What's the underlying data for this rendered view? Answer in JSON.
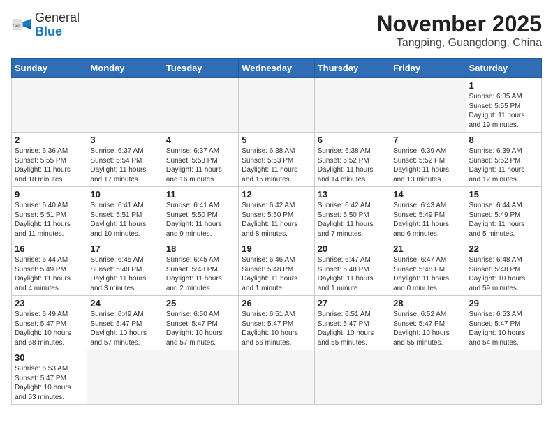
{
  "header": {
    "logo_general": "General",
    "logo_blue": "Blue",
    "month_title": "November 2025",
    "location": "Tangping, Guangdong, China"
  },
  "days_of_week": [
    "Sunday",
    "Monday",
    "Tuesday",
    "Wednesday",
    "Thursday",
    "Friday",
    "Saturday"
  ],
  "weeks": [
    [
      {
        "day": "",
        "info": ""
      },
      {
        "day": "",
        "info": ""
      },
      {
        "day": "",
        "info": ""
      },
      {
        "day": "",
        "info": ""
      },
      {
        "day": "",
        "info": ""
      },
      {
        "day": "",
        "info": ""
      },
      {
        "day": "1",
        "info": "Sunrise: 6:35 AM\nSunset: 5:55 PM\nDaylight: 11 hours\nand 19 minutes."
      }
    ],
    [
      {
        "day": "2",
        "info": "Sunrise: 6:36 AM\nSunset: 5:55 PM\nDaylight: 11 hours\nand 18 minutes."
      },
      {
        "day": "3",
        "info": "Sunrise: 6:37 AM\nSunset: 5:54 PM\nDaylight: 11 hours\nand 17 minutes."
      },
      {
        "day": "4",
        "info": "Sunrise: 6:37 AM\nSunset: 5:53 PM\nDaylight: 11 hours\nand 16 minutes."
      },
      {
        "day": "5",
        "info": "Sunrise: 6:38 AM\nSunset: 5:53 PM\nDaylight: 11 hours\nand 15 minutes."
      },
      {
        "day": "6",
        "info": "Sunrise: 6:38 AM\nSunset: 5:52 PM\nDaylight: 11 hours\nand 14 minutes."
      },
      {
        "day": "7",
        "info": "Sunrise: 6:39 AM\nSunset: 5:52 PM\nDaylight: 11 hours\nand 13 minutes."
      },
      {
        "day": "8",
        "info": "Sunrise: 6:39 AM\nSunset: 5:52 PM\nDaylight: 11 hours\nand 12 minutes."
      }
    ],
    [
      {
        "day": "9",
        "info": "Sunrise: 6:40 AM\nSunset: 5:51 PM\nDaylight: 11 hours\nand 11 minutes."
      },
      {
        "day": "10",
        "info": "Sunrise: 6:41 AM\nSunset: 5:51 PM\nDaylight: 11 hours\nand 10 minutes."
      },
      {
        "day": "11",
        "info": "Sunrise: 6:41 AM\nSunset: 5:50 PM\nDaylight: 11 hours\nand 9 minutes."
      },
      {
        "day": "12",
        "info": "Sunrise: 6:42 AM\nSunset: 5:50 PM\nDaylight: 11 hours\nand 8 minutes."
      },
      {
        "day": "13",
        "info": "Sunrise: 6:42 AM\nSunset: 5:50 PM\nDaylight: 11 hours\nand 7 minutes."
      },
      {
        "day": "14",
        "info": "Sunrise: 6:43 AM\nSunset: 5:49 PM\nDaylight: 11 hours\nand 6 minutes."
      },
      {
        "day": "15",
        "info": "Sunrise: 6:44 AM\nSunset: 5:49 PM\nDaylight: 11 hours\nand 5 minutes."
      }
    ],
    [
      {
        "day": "16",
        "info": "Sunrise: 6:44 AM\nSunset: 5:49 PM\nDaylight: 11 hours\nand 4 minutes."
      },
      {
        "day": "17",
        "info": "Sunrise: 6:45 AM\nSunset: 5:48 PM\nDaylight: 11 hours\nand 3 minutes."
      },
      {
        "day": "18",
        "info": "Sunrise: 6:45 AM\nSunset: 5:48 PM\nDaylight: 11 hours\nand 2 minutes."
      },
      {
        "day": "19",
        "info": "Sunrise: 6:46 AM\nSunset: 5:48 PM\nDaylight: 11 hours\nand 1 minute."
      },
      {
        "day": "20",
        "info": "Sunrise: 6:47 AM\nSunset: 5:48 PM\nDaylight: 11 hours\nand 1 minute."
      },
      {
        "day": "21",
        "info": "Sunrise: 6:47 AM\nSunset: 5:48 PM\nDaylight: 11 hours\nand 0 minutes."
      },
      {
        "day": "22",
        "info": "Sunrise: 6:48 AM\nSunset: 5:48 PM\nDaylight: 10 hours\nand 59 minutes."
      }
    ],
    [
      {
        "day": "23",
        "info": "Sunrise: 6:49 AM\nSunset: 5:47 PM\nDaylight: 10 hours\nand 58 minutes."
      },
      {
        "day": "24",
        "info": "Sunrise: 6:49 AM\nSunset: 5:47 PM\nDaylight: 10 hours\nand 57 minutes."
      },
      {
        "day": "25",
        "info": "Sunrise: 6:50 AM\nSunset: 5:47 PM\nDaylight: 10 hours\nand 57 minutes."
      },
      {
        "day": "26",
        "info": "Sunrise: 6:51 AM\nSunset: 5:47 PM\nDaylight: 10 hours\nand 56 minutes."
      },
      {
        "day": "27",
        "info": "Sunrise: 6:51 AM\nSunset: 5:47 PM\nDaylight: 10 hours\nand 55 minutes."
      },
      {
        "day": "28",
        "info": "Sunrise: 6:52 AM\nSunset: 5:47 PM\nDaylight: 10 hours\nand 55 minutes."
      },
      {
        "day": "29",
        "info": "Sunrise: 6:53 AM\nSunset: 5:47 PM\nDaylight: 10 hours\nand 54 minutes."
      }
    ],
    [
      {
        "day": "30",
        "info": "Sunrise: 6:53 AM\nSunset: 5:47 PM\nDaylight: 10 hours\nand 53 minutes."
      },
      {
        "day": "",
        "info": ""
      },
      {
        "day": "",
        "info": ""
      },
      {
        "day": "",
        "info": ""
      },
      {
        "day": "",
        "info": ""
      },
      {
        "day": "",
        "info": ""
      },
      {
        "day": "",
        "info": ""
      }
    ]
  ]
}
